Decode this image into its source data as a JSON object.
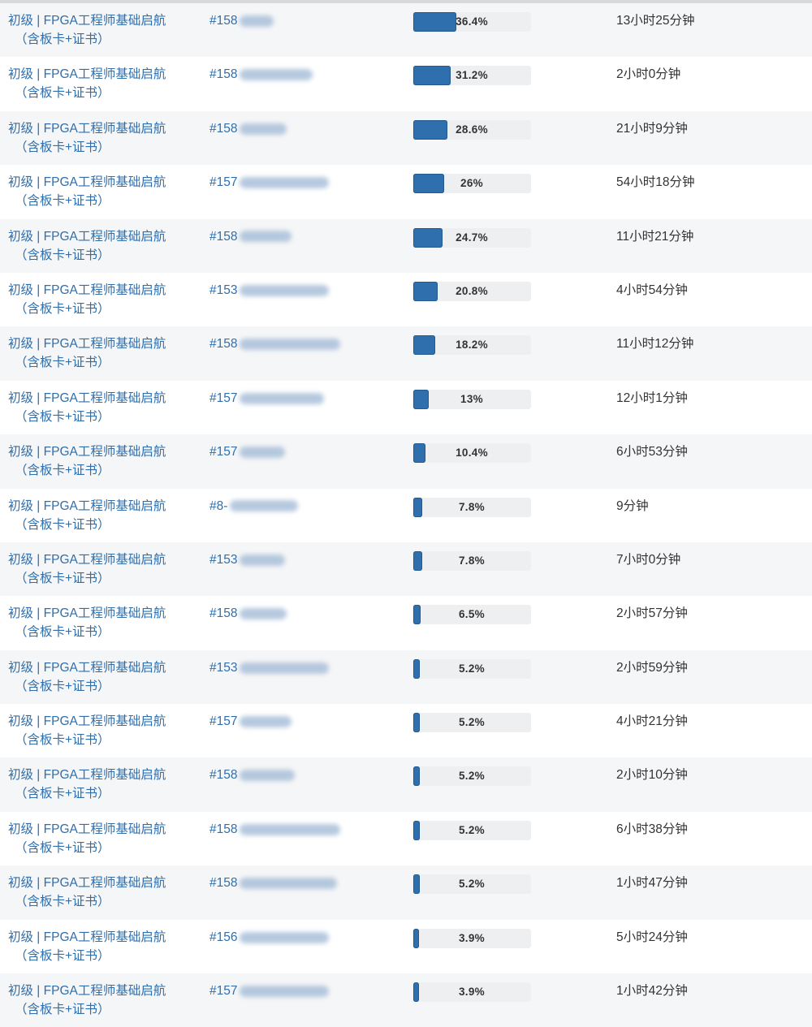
{
  "rows": [
    {
      "course_line1": "初级 | FPGA工程师基础启航",
      "course_line2": "（含板卡+证书）",
      "student_id": "#158",
      "blur_width": 42,
      "progress": 36.4,
      "progress_label": "36.4%",
      "duration": "13小时25分钟"
    },
    {
      "course_line1": "初级 | FPGA工程师基础启航",
      "course_line2": "（含板卡+证书）",
      "student_id": "#158",
      "blur_width": 90,
      "progress": 31.2,
      "progress_label": "31.2%",
      "duration": "2小时0分钟"
    },
    {
      "course_line1": "初级 | FPGA工程师基础启航",
      "course_line2": "（含板卡+证书）",
      "student_id": "#158",
      "blur_width": 58,
      "progress": 28.6,
      "progress_label": "28.6%",
      "duration": "21小时9分钟"
    },
    {
      "course_line1": "初级 | FPGA工程师基础启航",
      "course_line2": "（含板卡+证书）",
      "student_id": "#157",
      "blur_width": 110,
      "progress": 26,
      "progress_label": "26%",
      "duration": "54小时18分钟"
    },
    {
      "course_line1": "初级 | FPGA工程师基础启航",
      "course_line2": "（含板卡+证书）",
      "student_id": "#158",
      "blur_width": 64,
      "progress": 24.7,
      "progress_label": "24.7%",
      "duration": "11小时21分钟"
    },
    {
      "course_line1": "初级 | FPGA工程师基础启航",
      "course_line2": "（含板卡+证书）",
      "student_id": "#153",
      "blur_width": 110,
      "progress": 20.8,
      "progress_label": "20.8%",
      "duration": "4小时54分钟"
    },
    {
      "course_line1": "初级 | FPGA工程师基础启航",
      "course_line2": "（含板卡+证书）",
      "student_id": "#158",
      "blur_width": 124,
      "progress": 18.2,
      "progress_label": "18.2%",
      "duration": "11小时12分钟"
    },
    {
      "course_line1": "初级 | FPGA工程师基础启航",
      "course_line2": "（含板卡+证书）",
      "student_id": "#157",
      "blur_width": 104,
      "progress": 13,
      "progress_label": "13%",
      "duration": "12小时1分钟"
    },
    {
      "course_line1": "初级 | FPGA工程师基础启航",
      "course_line2": "（含板卡+证书）",
      "student_id": "#157",
      "blur_width": 56,
      "progress": 10.4,
      "progress_label": "10.4%",
      "duration": "6小时53分钟"
    },
    {
      "course_line1": "初级 | FPGA工程师基础启航",
      "course_line2": "（含板卡+证书）",
      "student_id": "#8-",
      "blur_width": 84,
      "progress": 7.8,
      "progress_label": "7.8%",
      "duration": "9分钟"
    },
    {
      "course_line1": "初级 | FPGA工程师基础启航",
      "course_line2": "（含板卡+证书）",
      "student_id": "#153",
      "blur_width": 56,
      "progress": 7.8,
      "progress_label": "7.8%",
      "duration": "7小时0分钟"
    },
    {
      "course_line1": "初级 | FPGA工程师基础启航",
      "course_line2": "（含板卡+证书）",
      "student_id": "#158",
      "blur_width": 58,
      "progress": 6.5,
      "progress_label": "6.5%",
      "duration": "2小时57分钟"
    },
    {
      "course_line1": "初级 | FPGA工程师基础启航",
      "course_line2": "（含板卡+证书）",
      "student_id": "#153",
      "blur_width": 110,
      "progress": 5.2,
      "progress_label": "5.2%",
      "duration": "2小时59分钟"
    },
    {
      "course_line1": "初级 | FPGA工程师基础启航",
      "course_line2": "（含板卡+证书）",
      "student_id": "#157",
      "blur_width": 64,
      "progress": 5.2,
      "progress_label": "5.2%",
      "duration": "4小时21分钟"
    },
    {
      "course_line1": "初级 | FPGA工程师基础启航",
      "course_line2": "（含板卡+证书）",
      "student_id": "#158",
      "blur_width": 68,
      "progress": 5.2,
      "progress_label": "5.2%",
      "duration": "2小时10分钟"
    },
    {
      "course_line1": "初级 | FPGA工程师基础启航",
      "course_line2": "（含板卡+证书）",
      "student_id": "#158",
      "blur_width": 124,
      "progress": 5.2,
      "progress_label": "5.2%",
      "duration": "6小时38分钟"
    },
    {
      "course_line1": "初级 | FPGA工程师基础启航",
      "course_line2": "（含板卡+证书）",
      "student_id": "#158",
      "blur_width": 120,
      "progress": 5.2,
      "progress_label": "5.2%",
      "duration": "1小时47分钟"
    },
    {
      "course_line1": "初级 | FPGA工程师基础启航",
      "course_line2": "（含板卡+证书）",
      "student_id": "#156",
      "blur_width": 110,
      "progress": 3.9,
      "progress_label": "3.9%",
      "duration": "5小时24分钟"
    },
    {
      "course_line1": "初级 | FPGA工程师基础启航",
      "course_line2": "（含板卡+证书）",
      "student_id": "#157",
      "blur_width": 110,
      "progress": 3.9,
      "progress_label": "3.9%",
      "duration": "1小时42分钟"
    }
  ],
  "colors": {
    "link": "#2f6fad",
    "bar_fill": "#2f6fad",
    "bar_track": "#eeeff0",
    "row_alt": "#f5f6f7"
  }
}
